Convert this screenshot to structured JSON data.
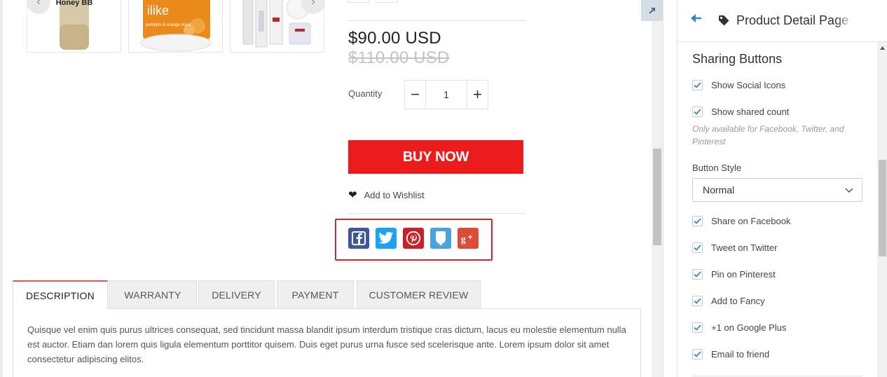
{
  "product": {
    "thumbnails": [
      {
        "label": "Honey BB",
        "alt": "honey-bb-bottle-image"
      },
      {
        "label": "ilike",
        "sublabel": "pumpkin & orange mask",
        "alt": "ilike-mask-jar-image"
      },
      {
        "label": "",
        "alt": "skincare-set-image"
      }
    ],
    "price": "$90.00 USD",
    "compare_price": "$110.00 USD",
    "quantity_label": "Quantity",
    "quantity_value": "1",
    "quantity_minus": "−",
    "quantity_plus": "+",
    "buy_now_label": "BUY NOW",
    "wishlist_label": "Add to Wishlist",
    "share_icons": [
      {
        "name": "facebook-share-icon",
        "color": "#3b5998"
      },
      {
        "name": "twitter-share-icon",
        "color": "#1da1f2"
      },
      {
        "name": "pinterest-share-icon",
        "color": "#cb2027"
      },
      {
        "name": "fancy-share-icon",
        "color": "#4aa3df"
      },
      {
        "name": "google-plus-share-icon",
        "color": "#dd4b39"
      }
    ],
    "tabs": [
      {
        "label": "DESCRIPTION",
        "active": true
      },
      {
        "label": "WARRANTY",
        "active": false
      },
      {
        "label": "DELIVERY",
        "active": false
      },
      {
        "label": "PAYMENT",
        "active": false
      },
      {
        "label": "CUSTOMER REVIEW",
        "active": false
      }
    ],
    "description": "Quisque vel enim quis purus ultrices consequat, sed tincidunt massa blandit ipsum interdum tristique cras dictum, lacus eu molestie elementum nulla est auctor. Etiam dan lorem quis ligula elementum porttitor quisem. Duis eget purus urna fusce sed scelerisque ante. Lorem ipsum dolor sit amet consectetur adipiscing elitos."
  },
  "panel": {
    "title": "Product Detail Page",
    "section_title": "Sharing Buttons",
    "options": [
      {
        "label": "Show Social Icons",
        "checked": true
      },
      {
        "label": "Show shared count",
        "checked": true
      }
    ],
    "hint": "Only available for Facebook, Twitter, and Pinterest",
    "button_style_label": "Button Style",
    "button_style_value": "Normal",
    "networks": [
      {
        "label": "Share on Facebook",
        "checked": true
      },
      {
        "label": "Tweet on Twitter",
        "checked": true
      },
      {
        "label": "Pin on Pinterest",
        "checked": true
      },
      {
        "label": "Add to Fancy",
        "checked": true
      },
      {
        "label": "+1 on Google Plus",
        "checked": true
      },
      {
        "label": "Email to friend",
        "checked": true
      }
    ]
  },
  "colors": {
    "buy_now": "#ed1c1c",
    "highlight_border": "#e0202b",
    "accent_blue": "#2f86c8",
    "active_tab_border": "#e0564f"
  }
}
